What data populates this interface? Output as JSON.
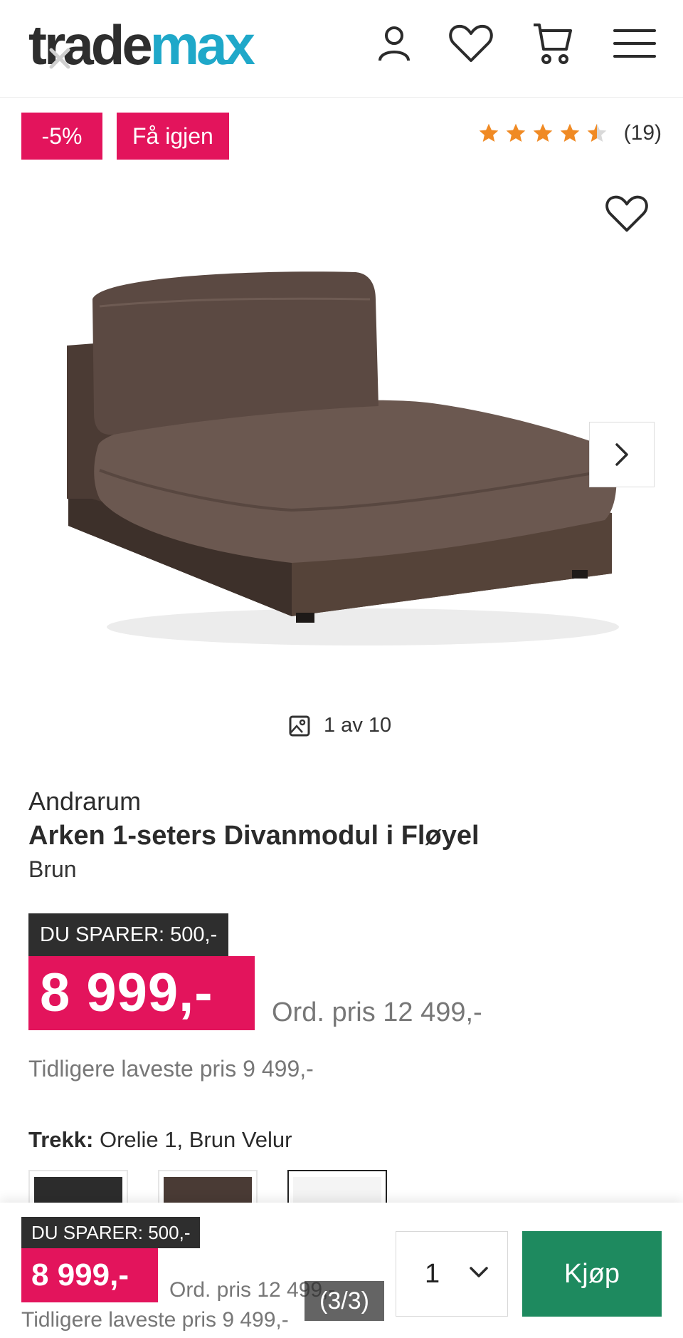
{
  "header": {
    "logo_part1": "trade",
    "logo_part2": "max"
  },
  "badges": {
    "discount": "-5%",
    "restock": "Få igjen"
  },
  "rating": {
    "stars": 4.5,
    "count_label": "(19)"
  },
  "gallery": {
    "counter": "1 av 10"
  },
  "product": {
    "brand": "Andrarum",
    "title": "Arken 1-seters Divanmodul i Fløyel",
    "color": "Brun"
  },
  "pricing": {
    "savings": "DU SPARER: 500,-",
    "price": "8 999,-",
    "ordinary": "Ord. pris 12 499,-",
    "lowest": "Tidligere laveste pris 9 499,-"
  },
  "cover": {
    "label": "Trekk:",
    "value": "Orelie 1, Brun Velur",
    "swatches": [
      {
        "name": "dark",
        "color": "#2c2c2c"
      },
      {
        "name": "brown",
        "color": "#4a3b35"
      },
      {
        "name": "selected-light",
        "color": "#f2f2f2"
      }
    ]
  },
  "sticky_bar": {
    "savings": "DU SPARER: 500,-",
    "price": "8 999,-",
    "ordinary": "Ord. pris 12 499,-",
    "lowest": "Tidligere laveste pris 9 499,-",
    "quantity": "1",
    "buy_label": "Kjøp"
  },
  "overlay": {
    "page_counter": "(3/3)"
  },
  "colors": {
    "accent_pink": "#e3145c",
    "logo_blue": "#1fa8c9",
    "buy_green": "#1e8a5f",
    "star_orange": "#f08a24"
  }
}
